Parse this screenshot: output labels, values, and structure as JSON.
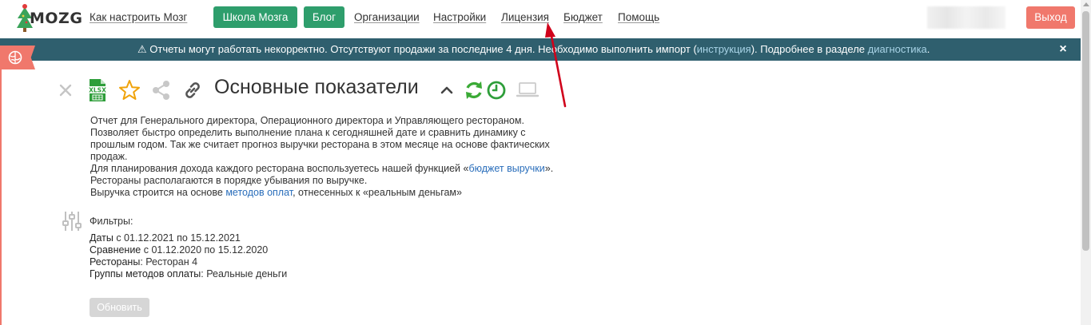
{
  "navbar": {
    "logo_text": "MOZG",
    "how_to_link": "Как настроить Мозг",
    "school_button": "Школа Мозга",
    "blog_button": "Блог",
    "links": [
      "Организации",
      "Настройки",
      "Лицензия",
      "Бюджет",
      "Помощь"
    ],
    "logout_button": "Выход"
  },
  "alert": {
    "icon": "warning-icon",
    "text_before": "Отчеты могут работать некорректно. Отсутствуют продажи за последние 4 дня. Необходимо выполнить импорт (",
    "instruction_link": "инструкция",
    "text_middle": "). Подробнее в разделе ",
    "diagnostics_link": "диагностика",
    "text_after": ".",
    "close": "×"
  },
  "report": {
    "title": "Основные показатели",
    "xlsx_label": "XLSX",
    "description": {
      "line1": "Отчет для Генерального директора, Операционного директора и Управляющего рестораном.",
      "line2": "Позволяет быстро определить выполнение плана к сегодняшней дате и сравнить динамику с",
      "line3": "прошлым годом. Так же считает прогноз выручки ресторана в этом месяце на основе фактических",
      "line4": "продаж.",
      "line5_before": "Для планирования дохода каждого ресторана воспользуетесь нашей функцией «",
      "line5_link": "бюджет выручки",
      "line5_after": "».",
      "line6": "Рестораны располагаются в порядке убывания по выручке.",
      "line7_before": "Выручка строится на основе ",
      "line7_link": "методов оплат",
      "line7_after": ", отнесенных к «реальным деньгам»"
    }
  },
  "filters": {
    "title": "Фильтры:",
    "dates_label": "Даты",
    "dates_value": " с 01.12.2021 по 15.12.2021",
    "compare_label": "Сравнение",
    "compare_value": " с 01.12.2020 по 15.12.2020",
    "restaurants_label": "Рестораны",
    "restaurants_value": ": Ресторан 4",
    "groups_label": "Группы методов оплаты",
    "groups_value": ": Реальные деньги"
  },
  "refresh_button": "Обновить",
  "colors": {
    "green": "#2e9e6c",
    "alert_bg": "#2f5f6e",
    "logout": "#f0786c",
    "star": "#f0a30a",
    "sync": "#3aaa35",
    "annotation": "#d0021b"
  }
}
